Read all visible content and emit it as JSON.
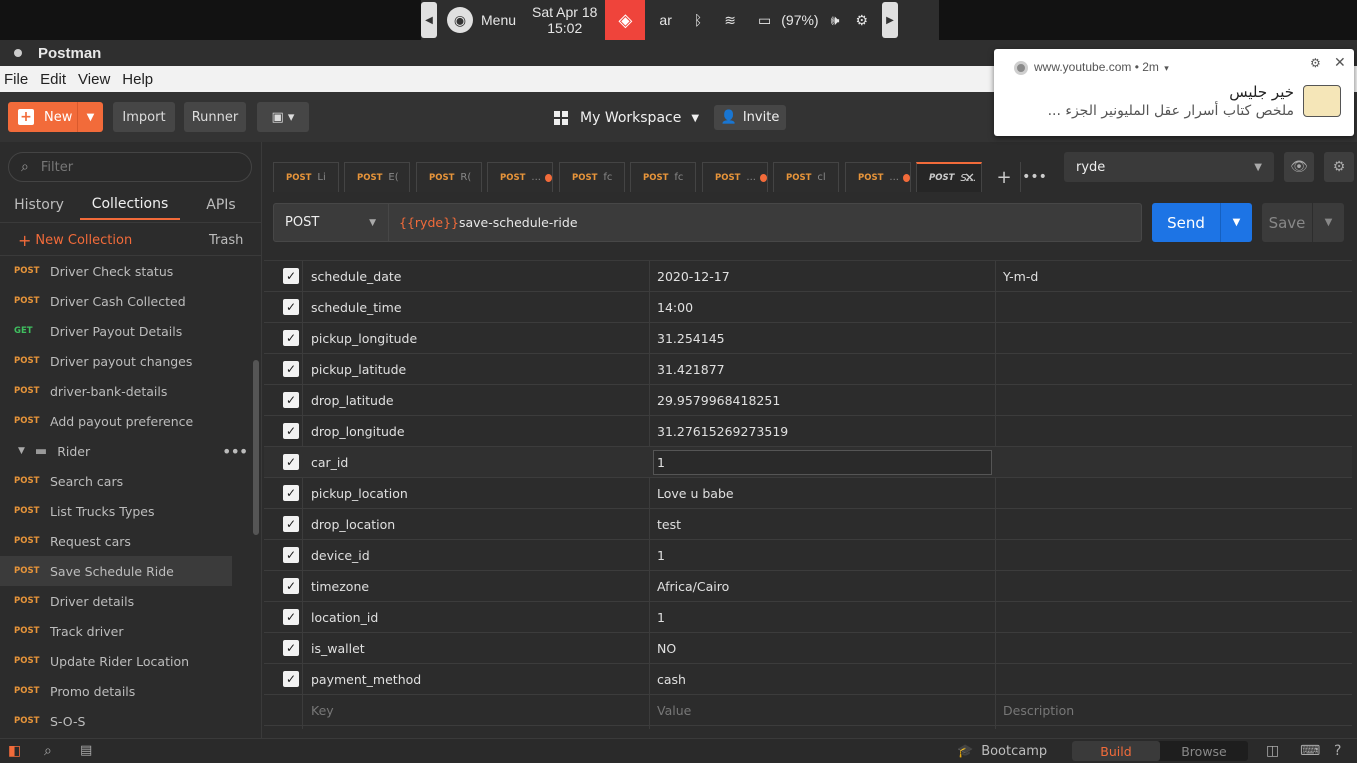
{
  "system_panel": {
    "menu_label": "Menu",
    "date": "Sat Apr 18",
    "time": "15:02",
    "keyboard_layout": "ar",
    "battery": "(97%)"
  },
  "window": {
    "title": "Postman"
  },
  "menubar": {
    "items": [
      "File",
      "Edit",
      "View",
      "Help"
    ]
  },
  "toolbar": {
    "new_label": "New",
    "import_label": "Import",
    "runner_label": "Runner",
    "workspace_label": "My Workspace",
    "invite_label": "Invite"
  },
  "sidebar": {
    "filter_placeholder": "Filter",
    "tabs": [
      "History",
      "Collections",
      "APIs"
    ],
    "new_collection_label": "New Collection",
    "trash_label": "Trash",
    "folder_name": "Rider",
    "items_before": [
      {
        "method": "POST",
        "name": "Driver Check status"
      },
      {
        "method": "POST",
        "name": "Driver Cash Collected"
      },
      {
        "method": "GET",
        "name": "Driver Payout Details"
      },
      {
        "method": "POST",
        "name": "Driver payout changes"
      },
      {
        "method": "POST",
        "name": "driver-bank-details"
      },
      {
        "method": "POST",
        "name": "Add payout preference"
      }
    ],
    "items_after": [
      {
        "method": "POST",
        "name": "Search cars"
      },
      {
        "method": "POST",
        "name": "List Trucks Types"
      },
      {
        "method": "POST",
        "name": "Request cars"
      },
      {
        "method": "POST",
        "name": "Save Schedule Ride"
      },
      {
        "method": "POST",
        "name": "Driver details"
      },
      {
        "method": "POST",
        "name": "Track driver"
      },
      {
        "method": "POST",
        "name": "Update Rider Location"
      },
      {
        "method": "POST",
        "name": "Promo details"
      },
      {
        "method": "POST",
        "name": "S-O-S"
      }
    ]
  },
  "request_tabs": [
    {
      "method": "POST",
      "name": "Li"
    },
    {
      "method": "POST",
      "name": "E("
    },
    {
      "method": "POST",
      "name": "R("
    },
    {
      "method": "POST",
      "name": "..."
    },
    {
      "method": "POST",
      "name": "fc"
    },
    {
      "method": "POST",
      "name": "fc"
    },
    {
      "method": "POST",
      "name": "..."
    },
    {
      "method": "POST",
      "name": "cl"
    },
    {
      "method": "POST",
      "name": "..."
    },
    {
      "method": "POST",
      "name": "S..."
    }
  ],
  "environment": {
    "selected": "ryde"
  },
  "request": {
    "method": "POST",
    "url_variable": "{{ryde}}",
    "url_path": "save-schedule-ride",
    "send_label": "Send",
    "save_label": "Save"
  },
  "params": {
    "rows": [
      {
        "key": "schedule_date",
        "value": "2020-12-17",
        "description": "Y-m-d"
      },
      {
        "key": "schedule_time",
        "value": "14:00",
        "description": ""
      },
      {
        "key": "pickup_longitude",
        "value": "31.254145",
        "description": ""
      },
      {
        "key": "pickup_latitude",
        "value": "31.421877",
        "description": ""
      },
      {
        "key": "drop_latitude",
        "value": "29.9579968418251",
        "description": ""
      },
      {
        "key": "drop_longitude",
        "value": "31.27615269273519",
        "description": ""
      },
      {
        "key": "car_id",
        "value": "1",
        "description": ""
      },
      {
        "key": "pickup_location",
        "value": "Love u babe",
        "description": ""
      },
      {
        "key": "drop_location",
        "value": "test",
        "description": ""
      },
      {
        "key": "device_id",
        "value": "1",
        "description": ""
      },
      {
        "key": "timezone",
        "value": "Africa/Cairo",
        "description": ""
      },
      {
        "key": "location_id",
        "value": "1",
        "description": ""
      },
      {
        "key": "is_wallet",
        "value": "NO",
        "description": ""
      },
      {
        "key": "payment_method",
        "value": "cash",
        "description": ""
      }
    ],
    "placeholder": {
      "key": "Key",
      "value": "Value",
      "description": "Description"
    }
  },
  "statusbar": {
    "bootcamp_label": "Bootcamp",
    "build_label": "Build",
    "browse_label": "Browse"
  },
  "notification": {
    "source": "www.youtube.com • 2m",
    "title": "خير جليس",
    "body": "ملخص كتاب أسرار عقل المليونير الجزء ..."
  },
  "colors": {
    "accent": "#f26b3a",
    "send": "#1d74e5",
    "post_method": "#e8953a",
    "get_method": "#3fbf5f"
  }
}
